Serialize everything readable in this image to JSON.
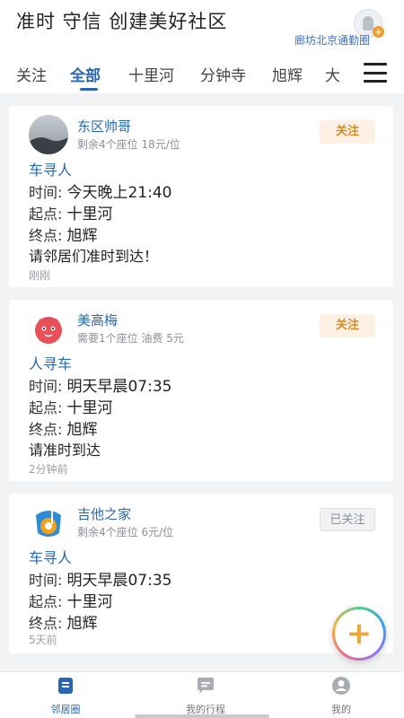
{
  "header": {
    "slogan": "准时 守信 创建美好社区",
    "region": "廊坊北京通勤圈"
  },
  "tabs": [
    {
      "label": "关注"
    },
    {
      "label": "全部"
    },
    {
      "label": "十里河"
    },
    {
      "label": "分钟寺"
    },
    {
      "label": "旭辉"
    },
    {
      "label": "大"
    }
  ],
  "posts": [
    {
      "user": "东区帅哥",
      "meta": "剩余4个座位  18元/位",
      "follow": "关注",
      "type": "车寻人",
      "time_label": "时间: ",
      "time": "今天晚上21:40",
      "from_label": "起点: ",
      "from": "十里河",
      "to_label": "终点: ",
      "to": "旭辉",
      "note": "请邻居们准时到达！",
      "ago": "刚刚"
    },
    {
      "user": "美高梅",
      "meta": "需要1个座位 油费 5元",
      "follow": "关注",
      "type": "人寻车",
      "time_label": "时间: ",
      "time": "明天早晨07:35",
      "from_label": "起点: ",
      "from": "十里河",
      "to_label": "终点: ",
      "to": "旭辉",
      "note": "请准时到达",
      "ago": "2分钟前"
    },
    {
      "user": "吉他之家",
      "meta": "剩余4个座位  6元/位",
      "follow": "已关注",
      "type": "车寻人",
      "time_label": "时间: ",
      "time": "明天早晨07:35",
      "from_label": "起点: ",
      "from": "十里河",
      "to_label": "终点: ",
      "to": "旭辉",
      "ago": "5天前"
    }
  ],
  "fab": {
    "symbol": "+"
  },
  "nav": [
    {
      "label": "邻居圈",
      "icon": "community-icon"
    },
    {
      "label": "我的行程",
      "icon": "chat-icon"
    },
    {
      "label": "我的",
      "icon": "profile-icon"
    }
  ],
  "colors": {
    "accent": "#2a67b1",
    "follow": "#d98a1f"
  }
}
